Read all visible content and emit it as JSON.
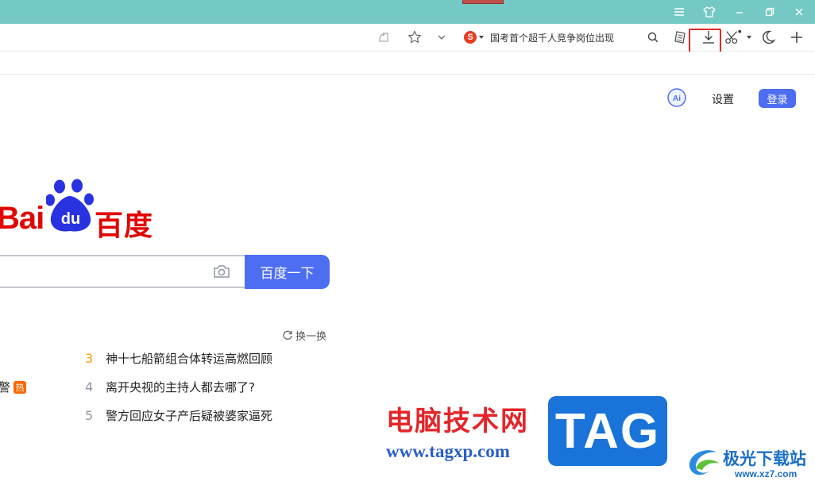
{
  "toolbar": {
    "news_ticker_text": "国考首个超千人竞争岗位出现",
    "search_engine_logo_letter": "S"
  },
  "page": {
    "ai_label": "Ai",
    "settings_label": "设置",
    "login_label": "登录",
    "logo_latin": "Bai",
    "logo_du": "du",
    "logo_cn": "百度",
    "search_button_label": "百度一下",
    "refresh_label": "换一换",
    "left_cut_text": "警",
    "left_cut_badge": "热",
    "hot_list": [
      {
        "rank": "3",
        "title": "神十七船箭组合体转运高燃回顾"
      },
      {
        "rank": "4",
        "title": "离开央视的主持人都去哪了?"
      },
      {
        "rank": "5",
        "title": "警方回应女子产后疑被婆家逼死"
      }
    ]
  },
  "watermark": {
    "site_cn": "电脑技术网",
    "site_url": "www.tagxp.com",
    "tag_logo": "TAG",
    "xz7_cn": "极光下载站",
    "xz7_url": "www.xz7.com"
  },
  "colors": {
    "titlebar": "#74c9c5",
    "accent": "#4e6ef2",
    "baidu_red": "#e10602",
    "baidu_blue": "#2932e1",
    "highlight_box": "#e0282b"
  }
}
